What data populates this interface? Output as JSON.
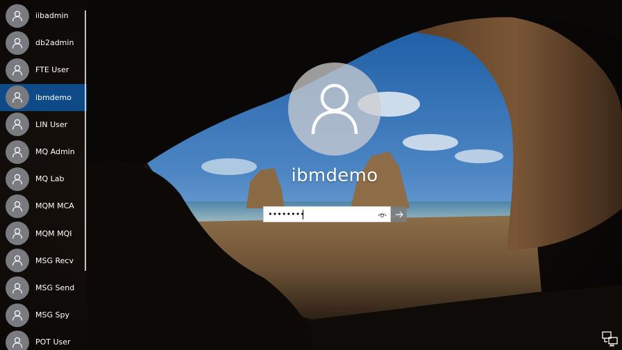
{
  "users": [
    {
      "name": "iibadmin",
      "selected": false
    },
    {
      "name": "db2admin",
      "selected": false
    },
    {
      "name": "FTE User",
      "selected": false
    },
    {
      "name": "ibmdemo",
      "selected": true
    },
    {
      "name": "LIN User",
      "selected": false
    },
    {
      "name": "MQ Admin",
      "selected": false
    },
    {
      "name": "MQ Lab",
      "selected": false
    },
    {
      "name": "MQM MCA",
      "selected": false
    },
    {
      "name": "MQM MQI",
      "selected": false
    },
    {
      "name": "MSG Recv",
      "selected": false
    },
    {
      "name": "MSG Send",
      "selected": false
    },
    {
      "name": "MSG Spy",
      "selected": false
    },
    {
      "name": "POT User",
      "selected": false
    }
  ],
  "signin": {
    "username": "ibmdemo",
    "password_value": "********",
    "reveal_icon": "eye-icon",
    "submit_icon": "arrow-right-icon"
  },
  "footer": {
    "network_icon": "network-icon"
  },
  "colors": {
    "selected_item": "#0e4a88",
    "avatar_gray": "#797b80"
  }
}
